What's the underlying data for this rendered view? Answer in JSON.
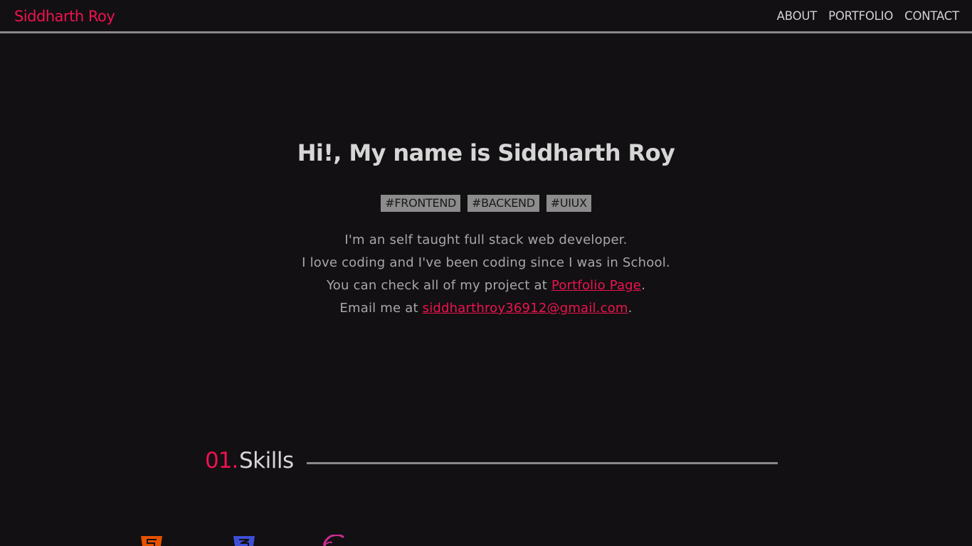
{
  "header": {
    "brand": "Siddharth Roy",
    "nav": [
      "ABOUT",
      "PORTFOLIO",
      "CONTACT"
    ]
  },
  "hero": {
    "title": "Hi!, My name is Siddharth Roy",
    "tags": [
      "#FRONTEND",
      "#BACKEND",
      "#UIUX"
    ],
    "line1": "I'm an self taught full stack web developer.",
    "line2": "I love coding and I've been coding since I was in School.",
    "line3_prefix": "You can check all of my project at ",
    "line3_link": "Portfolio Page",
    "line3_suffix": ".",
    "line4_prefix": "Email me at ",
    "line4_link": "siddharthroy36912@gmail.com",
    "line4_suffix": "."
  },
  "skills": {
    "number": "01.",
    "title": "Skills",
    "icons": [
      "html5-icon",
      "css3-icon",
      "sass-icon"
    ]
  },
  "colors": {
    "accent": "#ef1250",
    "background": "#121012",
    "html5": "#e65100",
    "css3": "#3d4fd8",
    "sass": "#cc2c8f"
  }
}
